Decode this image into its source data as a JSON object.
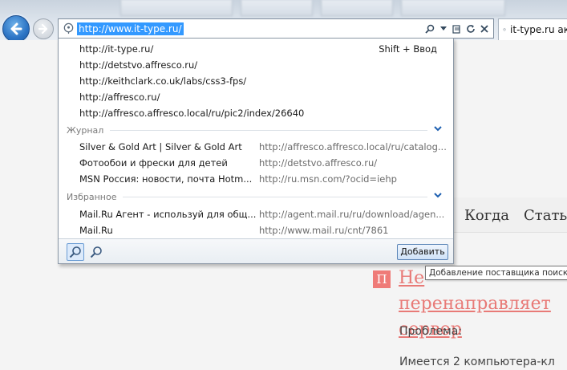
{
  "address_bar": {
    "url": "http://www.it-type.ru/",
    "icons": [
      "site-icon",
      "search-icon",
      "dropdown-arrow-icon",
      "compatibility-icon",
      "refresh-icon",
      "close-icon"
    ]
  },
  "tab": {
    "title": "it-type.ru ак"
  },
  "dropdown": {
    "suggestions": [
      "http://it-type.ru/",
      "http://detstvo.affresco.ru/",
      "http://keithclark.co.uk/labs/css3-fps/",
      "http://affresco.ru/",
      "http://affresco.affresco.local/ru/pic2/index/26640"
    ],
    "shortcut": "Shift + Ввод",
    "history": {
      "heading": "Журнал",
      "items": [
        {
          "title": "Silver & Gold Art | Silver & Gold Art",
          "url": "http://affresco.affresco.local/ru/catalog..."
        },
        {
          "title": "Фотообои и фрески для детей",
          "url": "http://detstvo.affresco.ru/"
        },
        {
          "title": "MSN Россия: новости, почта Hotm...",
          "url": "http://ru.msn.com/?ocid=iehp"
        }
      ]
    },
    "favorites": {
      "heading": "Избранное",
      "items": [
        {
          "title": "Mail.Ru Агент - используй для общ...",
          "url": "http://agent.mail.ru/ru/download/agen..."
        },
        {
          "title": "Mail.Ru",
          "url": "http://www.mail.ru/cnt/7861"
        }
      ]
    },
    "add_button": "Добавить",
    "tooltip": "Добавление поставщика поиска"
  },
  "page": {
    "menu": [
      "Когда",
      "Статьи"
    ],
    "post_badge": "П",
    "post_title": "Не перенаправляет сервер",
    "problem_label": "Проблема:",
    "description": "Имеется 2 компьютера-кл"
  },
  "colors": {
    "selection": "#3399ff",
    "accent_link": "#e87a77",
    "badge": "#ef7b78"
  }
}
